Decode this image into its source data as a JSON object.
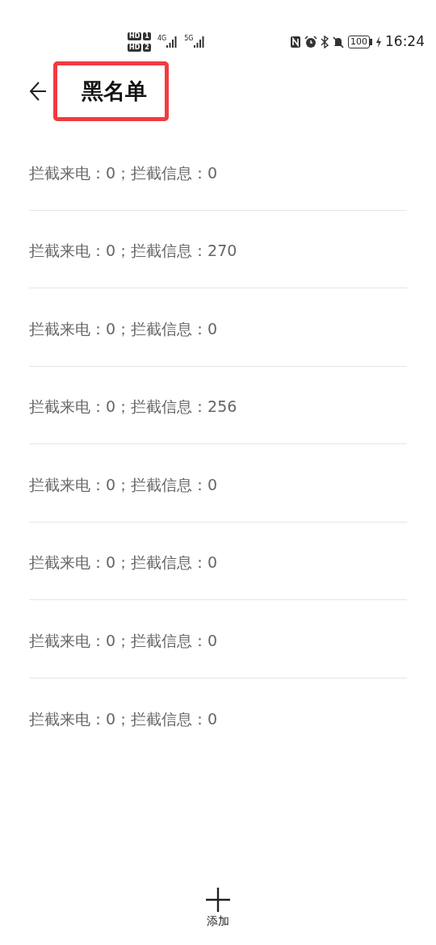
{
  "status_bar": {
    "sims": [
      {
        "label": "HD",
        "slot": "1"
      },
      {
        "label": "HD",
        "slot": "2"
      }
    ],
    "networks": [
      "4G",
      "5G"
    ],
    "battery": "100",
    "time": "16:24"
  },
  "header": {
    "title": "黑名单",
    "highlighted": true
  },
  "entries": [
    {
      "text": "拦截来电：0；拦截信息：0"
    },
    {
      "text": "拦截来电：0；拦截信息：270"
    },
    {
      "text": "拦截来电：0；拦截信息：0"
    },
    {
      "text": "拦截来电：0；拦截信息：256"
    },
    {
      "text": "拦截来电：0；拦截信息：0"
    },
    {
      "text": "拦截来电：0；拦截信息：0"
    },
    {
      "text": "拦截来电：0；拦截信息：0"
    },
    {
      "text": "拦截来电：0；拦截信息：0"
    }
  ],
  "add_button": {
    "label": "添加"
  }
}
